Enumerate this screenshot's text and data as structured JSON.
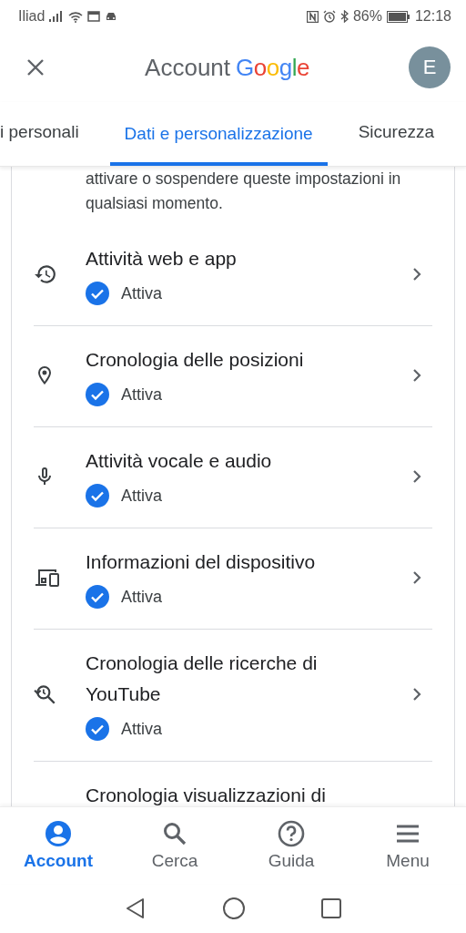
{
  "status_bar": {
    "carrier": "Iliad",
    "battery": "86%",
    "time": "12:18"
  },
  "header": {
    "title_prefix": "Account",
    "title_brand": "Google",
    "avatar_letter": "E"
  },
  "tabs": [
    {
      "label": "i personali",
      "selected": false
    },
    {
      "label": "Dati e personalizzazione",
      "selected": true
    },
    {
      "label": "Sicurezza",
      "selected": false
    }
  ],
  "intro": "attivare o sospendere queste impostazioni in qualsiasi momento.",
  "settings": [
    {
      "kind": "history",
      "title": "Attività web e app",
      "status": "Attiva",
      "active": true
    },
    {
      "kind": "location",
      "title": "Cronologia delle posizioni",
      "status": "Attiva",
      "active": true
    },
    {
      "kind": "voice",
      "title": "Attività vocale e audio",
      "status": "Attiva",
      "active": true
    },
    {
      "kind": "devices",
      "title": "Informazioni del dispositivo",
      "status": "Attiva",
      "active": true
    },
    {
      "kind": "search_history",
      "title": "Cronologia delle ricerche di YouTube",
      "status": "Attiva",
      "active": true
    },
    {
      "kind": "none",
      "title": "Cronologia visualizzazioni di"
    }
  ],
  "bottom_nav": [
    {
      "kind": "account",
      "label": "Account",
      "selected": true
    },
    {
      "kind": "search",
      "label": "Cerca",
      "selected": false
    },
    {
      "kind": "help",
      "label": "Guida",
      "selected": false
    },
    {
      "kind": "menu",
      "label": "Menu",
      "selected": false
    }
  ]
}
